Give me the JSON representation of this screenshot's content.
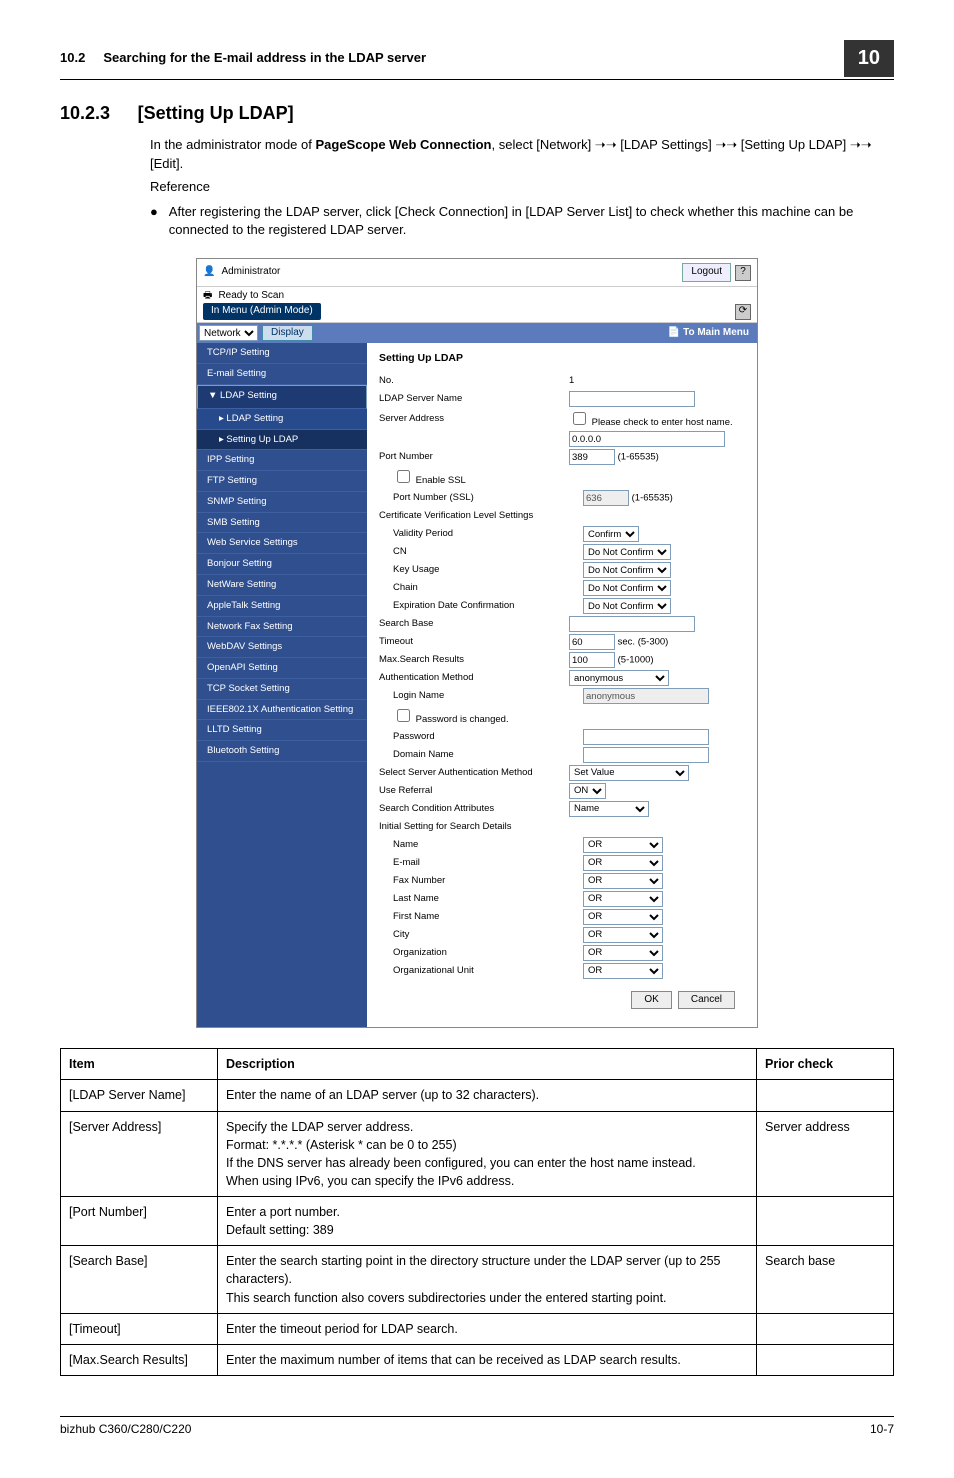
{
  "header": {
    "section_no": "10.2",
    "section_title": "Searching for the E-mail address in the LDAP server",
    "chip": "10"
  },
  "section": {
    "no": "10.2.3",
    "title": "[Setting Up LDAP]"
  },
  "intro": {
    "p1a": "In the administrator mode of ",
    "bold1": "PageScope Web Connection",
    "p1b": ", select [Network] ➝➝ [LDAP Settings] ➝➝ [Setting Up LDAP] ➝➝ [Edit].",
    "ref": "Reference",
    "bullet": "After registering the LDAP server, click [Check Connection] in [LDAP Server List] to check whether this machine can be connected to the registered LDAP server."
  },
  "ss": {
    "admin": "Administrator",
    "logout": "Logout",
    "ready": "Ready to Scan",
    "mode": "In Menu (Admin Mode)",
    "network": "Network",
    "display": "Display",
    "mainmenu": "To Main Menu",
    "side": [
      "TCP/IP Setting",
      "E-mail Setting",
      "LDAP Setting",
      "LDAP Setting",
      "Setting Up LDAP",
      "IPP Setting",
      "FTP Setting",
      "SNMP Setting",
      "SMB Setting",
      "Web Service Settings",
      "Bonjour Setting",
      "NetWare Setting",
      "AppleTalk Setting",
      "Network Fax Setting",
      "WebDAV Settings",
      "OpenAPI Setting",
      "TCP Socket Setting",
      "IEEE802.1X Authentication Setting",
      "LLTD Setting",
      "Bluetooth Setting"
    ],
    "heading": "Setting Up LDAP",
    "rows": {
      "no": {
        "l": "No.",
        "v": "1"
      },
      "srvname": {
        "l": "LDAP Server Name"
      },
      "srvaddr": {
        "l": "Server Address",
        "chk": "Please check to enter host name.",
        "v": "0.0.0.0"
      },
      "portnum": {
        "l": "Port Number",
        "v": "389",
        "r": "(1-65535)"
      },
      "enablessl": {
        "l": "Enable SSL"
      },
      "portssl": {
        "l": "Port Number (SSL)",
        "v": "636",
        "r": "(1-65535)"
      },
      "certhdr": {
        "l": "Certificate Verification Level Settings"
      },
      "validity": {
        "l": "Validity Period",
        "v": "Confirm"
      },
      "cn": {
        "l": "CN",
        "v": "Do Not Confirm"
      },
      "keyusage": {
        "l": "Key Usage",
        "v": "Do Not Confirm"
      },
      "chain": {
        "l": "Chain",
        "v": "Do Not Confirm"
      },
      "expdate": {
        "l": "Expiration Date Confirmation",
        "v": "Do Not Confirm"
      },
      "searchbase": {
        "l": "Search Base"
      },
      "timeout": {
        "l": "Timeout",
        "v": "60",
        "r": "sec. (5-300)"
      },
      "maxres": {
        "l": "Max.Search Results",
        "v": "100",
        "r": "(5-1000)"
      },
      "authmethod": {
        "l": "Authentication Method",
        "v": "anonymous"
      },
      "login": {
        "l": "Login Name",
        "v": "anonymous"
      },
      "pwdchg": {
        "l": "Password is changed."
      },
      "pwd": {
        "l": "Password"
      },
      "domain": {
        "l": "Domain Name"
      },
      "selsrvauth": {
        "l": "Select Server Authentication Method",
        "v": "Set Value"
      },
      "useref": {
        "l": "Use Referral",
        "v": "ON"
      },
      "searchcond": {
        "l": "Search Condition Attributes",
        "v": "Name"
      },
      "initset": {
        "l": "Initial Setting for Search Details"
      },
      "name": {
        "l": "Name",
        "v": "OR"
      },
      "email": {
        "l": "E-mail",
        "v": "OR"
      },
      "fax": {
        "l": "Fax Number",
        "v": "OR"
      },
      "lname": {
        "l": "Last Name",
        "v": "OR"
      },
      "fname": {
        "l": "First Name",
        "v": "OR"
      },
      "city": {
        "l": "City",
        "v": "OR"
      },
      "org": {
        "l": "Organization",
        "v": "OR"
      },
      "orgunit": {
        "l": "Organizational Unit",
        "v": "OR"
      }
    },
    "ok": "OK",
    "cancel": "Cancel"
  },
  "table": {
    "h1": "Item",
    "h2": "Description",
    "h3": "Prior check",
    "rows": [
      {
        "i": "[LDAP Server Name]",
        "d": "Enter the name of an LDAP server (up to 32 characters).",
        "p": ""
      },
      {
        "i": "[Server Address]",
        "d": "Specify the LDAP server address.\nFormat: *.*.*.* (Asterisk * can be 0 to 255)\nIf the DNS server has already been configured, you can enter the host name instead.\nWhen using IPv6, you can specify the IPv6 address.",
        "p": "Server address"
      },
      {
        "i": "[Port Number]",
        "d": "Enter a port number.\nDefault setting: 389",
        "p": ""
      },
      {
        "i": "[Search Base]",
        "d": "Enter the search starting point in the directory structure under the LDAP server (up to 255 characters).\nThis search function also covers subdirectories under the entered starting point.",
        "p": "Search base"
      },
      {
        "i": "[Timeout]",
        "d": "Enter the timeout period for LDAP search.",
        "p": ""
      },
      {
        "i": "[Max.Search Results]",
        "d": "Enter the maximum number of items that can be received as LDAP search results.",
        "p": ""
      }
    ]
  },
  "footer": {
    "left": "bizhub C360/C280/C220",
    "right": "10-7"
  }
}
